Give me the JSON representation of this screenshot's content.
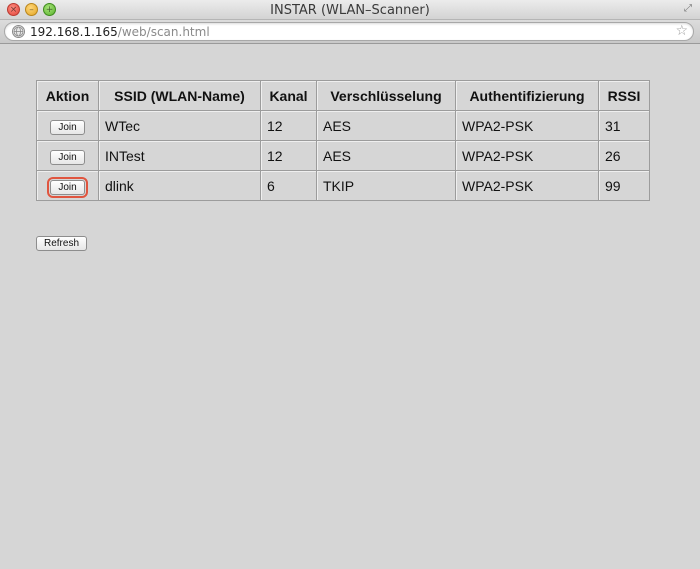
{
  "window": {
    "title": "INSTAR (WLAN–Scanner)",
    "close_glyph": "×",
    "min_glyph": "–",
    "max_glyph": "+",
    "fullscreen_glyph": "⤢"
  },
  "address_bar": {
    "host": "192.168.1.165",
    "path": "/web/scan.html",
    "bookmark_glyph": "☆"
  },
  "table": {
    "headers": [
      "Aktion",
      "SSID (WLAN-Name)",
      "Kanal",
      "Verschlüsselung",
      "Authentifizierung",
      "RSSI"
    ],
    "rows": [
      {
        "action": "Join",
        "ssid": "WTec",
        "kanal": "12",
        "verschluesselung": "AES",
        "auth": "WPA2-PSK",
        "rssi": "31"
      },
      {
        "action": "Join",
        "ssid": "INTest",
        "kanal": "12",
        "verschluesselung": "AES",
        "auth": "WPA2-PSK",
        "rssi": "26"
      },
      {
        "action": "Join",
        "ssid": "dlink",
        "kanal": "6",
        "verschluesselung": "TKIP",
        "auth": "WPA2-PSK",
        "rssi": "99"
      }
    ]
  },
  "refresh_label": "Refresh",
  "icons": {
    "close": "close-icon",
    "minimize": "minimize-icon",
    "maximize": "maximize-icon",
    "fullscreen": "fullscreen-icon",
    "globe": "globe-icon",
    "bookmark": "star-icon"
  },
  "colors": {
    "page_background": "#d6d6d6",
    "highlight": "#e0553f"
  }
}
